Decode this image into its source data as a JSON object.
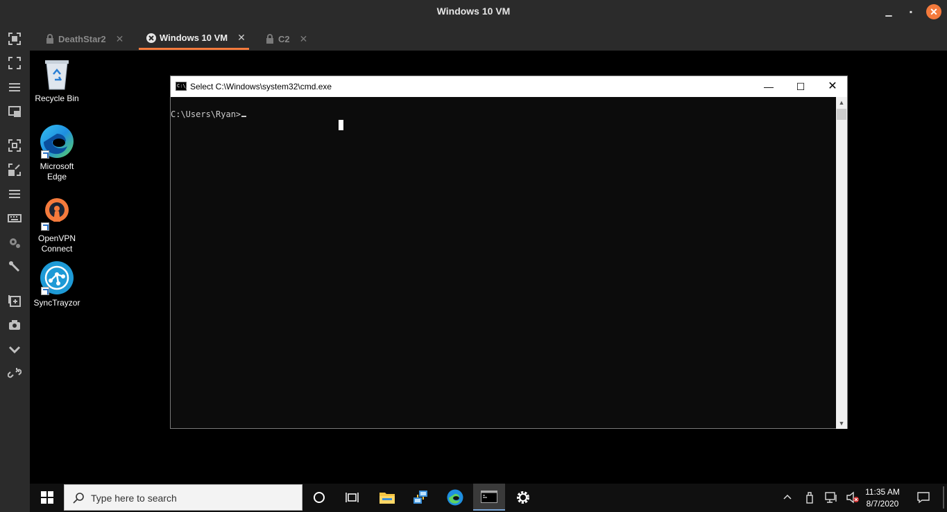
{
  "app": {
    "title": "Windows 10 VM",
    "controls": {
      "minimize": "▁",
      "maximize": "▪",
      "close": "✕"
    }
  },
  "tool_rail": [
    "screenshot-icon",
    "fullscreen-icon",
    "menu-icon",
    "window-icon",
    "screenshot-alt-icon",
    "resize-icon",
    "menu-alt-icon",
    "keyboard-icon",
    "settings-icon",
    "wrench-icon",
    "add-window-icon",
    "camera-icon",
    "chevron-down-icon",
    "unlink-icon"
  ],
  "tabs": [
    {
      "label": "DeathStar2",
      "close": "✕",
      "icon": "lock-icon"
    },
    {
      "label": "Windows 10 VM",
      "close": "✕",
      "icon": "windows-vm-icon"
    },
    {
      "label": "C2",
      "close": "✕",
      "icon": "lock-icon"
    }
  ],
  "desktop_icons": [
    {
      "label": "Recycle Bin"
    },
    {
      "label": "Microsoft Edge"
    },
    {
      "label": "OpenVPN Connect"
    },
    {
      "label": "SyncTrayzor"
    }
  ],
  "cmd": {
    "icon_text": "C:\\_",
    "title": "Select C:\\Windows\\system32\\cmd.exe",
    "controls": {
      "minimize": "—",
      "maximize": "☐",
      "close": "✕"
    },
    "prompt": "C:\\Users\\Ryan>",
    "scroll_up": "▲",
    "scroll_down": "▼"
  },
  "taskbar": {
    "search_placeholder": "Type here to search",
    "clock_time": "11:35 AM",
    "clock_date": "8/7/2020"
  }
}
